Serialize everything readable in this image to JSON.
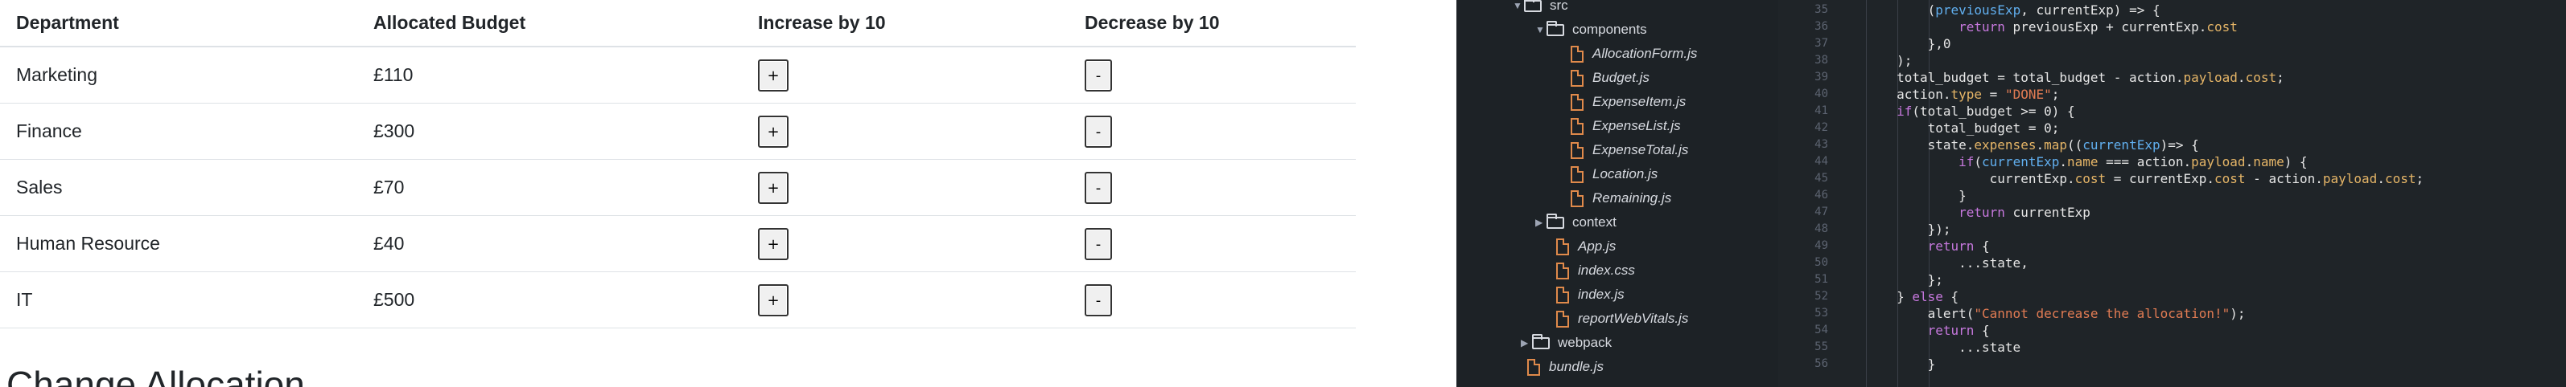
{
  "table": {
    "headers": [
      "Department",
      "Allocated Budget",
      "Increase by 10",
      "Decrease by 10"
    ],
    "rows": [
      {
        "department": "Marketing",
        "budget": "£110",
        "increase": "+",
        "decrease": "-"
      },
      {
        "department": "Finance",
        "budget": "£300",
        "increase": "+",
        "decrease": "-"
      },
      {
        "department": "Sales",
        "budget": "£70",
        "increase": "+",
        "decrease": "-"
      },
      {
        "department": "Human Resource",
        "budget": "£40",
        "increase": "+",
        "decrease": "-"
      },
      {
        "department": "IT",
        "budget": "£500",
        "increase": "+",
        "decrease": "-"
      }
    ]
  },
  "change_allocation_title": "Change Allocation",
  "file_tree": [
    {
      "label": "src",
      "type": "folder",
      "state": "open"
    },
    {
      "label": "components",
      "type": "folder",
      "state": "open"
    },
    {
      "label": "AllocationForm.js",
      "type": "file"
    },
    {
      "label": "Budget.js",
      "type": "file"
    },
    {
      "label": "ExpenseItem.js",
      "type": "file"
    },
    {
      "label": "ExpenseList.js",
      "type": "file"
    },
    {
      "label": "ExpenseTotal.js",
      "type": "file"
    },
    {
      "label": "Location.js",
      "type": "file"
    },
    {
      "label": "Remaining.js",
      "type": "file"
    },
    {
      "label": "context",
      "type": "folder",
      "state": "closed"
    },
    {
      "label": "App.js",
      "type": "file"
    },
    {
      "label": "index.css",
      "type": "file"
    },
    {
      "label": "index.js",
      "type": "file"
    },
    {
      "label": "reportWebVitals.js",
      "type": "file"
    },
    {
      "label": "webpack",
      "type": "folder",
      "state": "closed"
    },
    {
      "label": "bundle.js",
      "type": "file"
    }
  ],
  "line_numbers": [
    "35",
    "36",
    "37",
    "38",
    "39",
    "40",
    "41",
    "42",
    "43",
    "44",
    "45",
    "46",
    "47",
    "48",
    "49",
    "50",
    "51",
    "52",
    "53",
    "54",
    "55",
    "56"
  ],
  "code_lines": [
    "            (previousExp, currentExp) => {",
    "                return previousExp + currentExp.cost",
    "            },0",
    "        );",
    "        total_budget = total_budget - action.payload.cost;",
    "        action.type = \"DONE\";",
    "        if(total_budget >= 0) {",
    "            total_budget = 0;",
    "            state.expenses.map((currentExp)=> {",
    "                if(currentExp.name === action.payload.name) {",
    "                    currentExp.cost = currentExp.cost - action.payload.cost;",
    "                }",
    "                return currentExp",
    "            });",
    "            return {",
    "                ...state,",
    "            };",
    "        } else {",
    "            alert(\"Cannot decrease the allocation!\");",
    "            return {",
    "                ...state",
    "            }"
  ],
  "colors": {
    "editor_bg": "#1f2428",
    "keyword": "#c678dd",
    "property": "#e5b567",
    "string": "#e07b53",
    "file_icon": "#e08a4b"
  }
}
